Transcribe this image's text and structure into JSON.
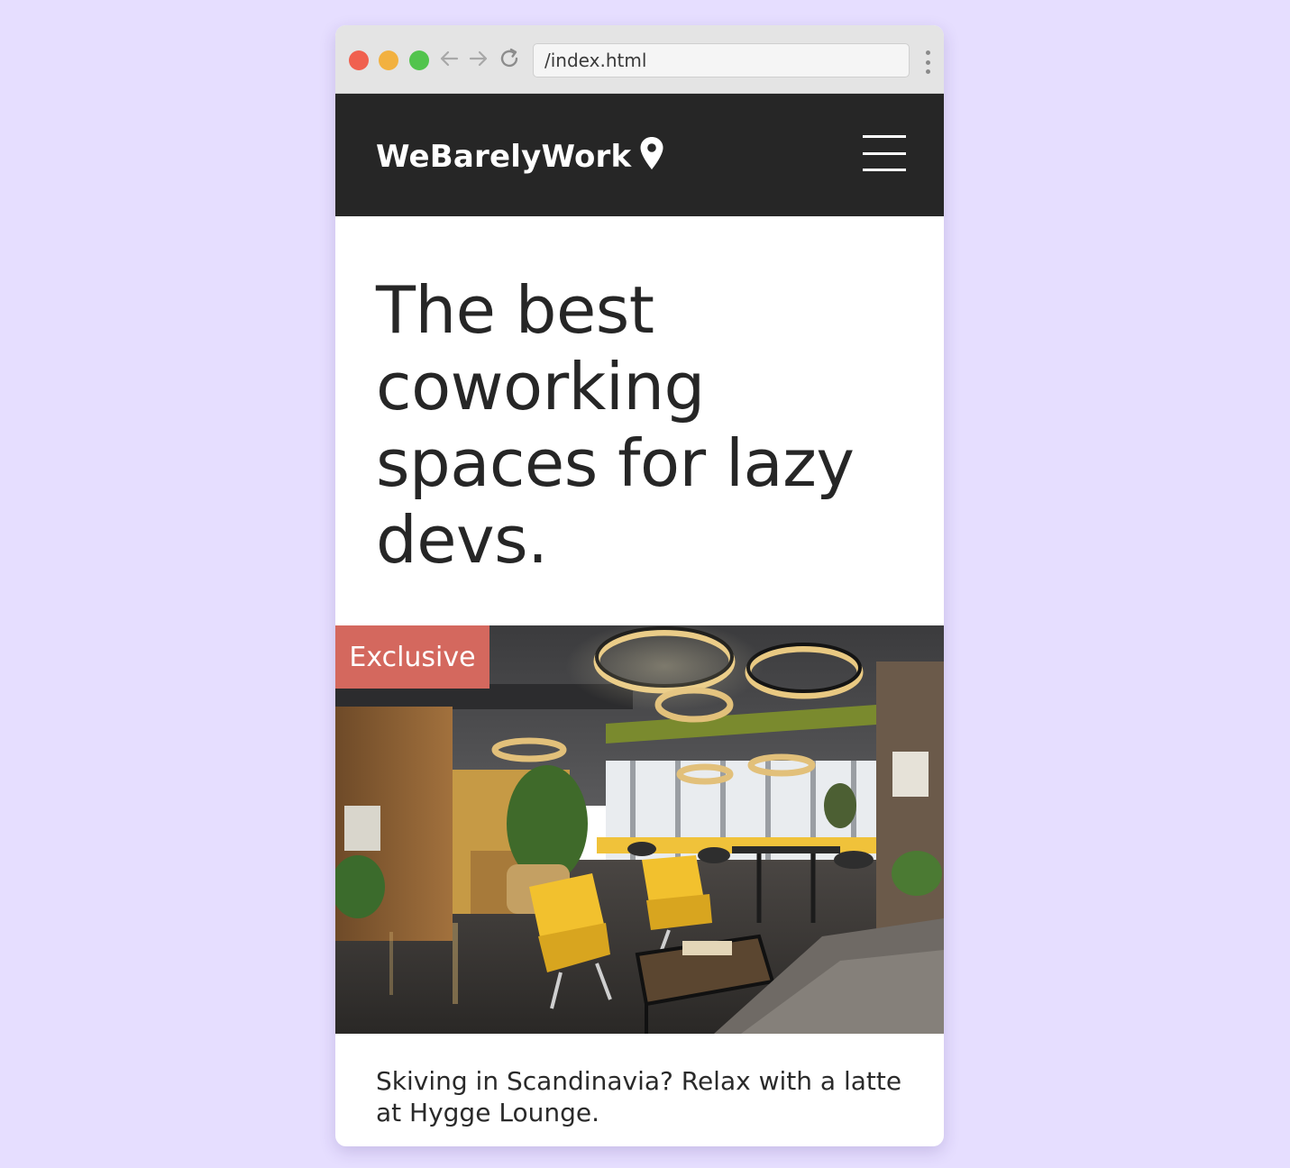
{
  "browser": {
    "url": "/index.html"
  },
  "header": {
    "logo": "WeBarelyWork",
    "icons": [
      "map-pin-icon",
      "hamburger-menu-icon"
    ]
  },
  "hero": {
    "title": "The best coworking spaces for lazy devs."
  },
  "feature": {
    "badge": "Exclusive",
    "caption": "Skiving in Scandinavia? Relax with a latte at Hygge Lounge."
  },
  "colors": {
    "background": "#e6deff",
    "header": "#262626",
    "badge": "#d4685e"
  }
}
